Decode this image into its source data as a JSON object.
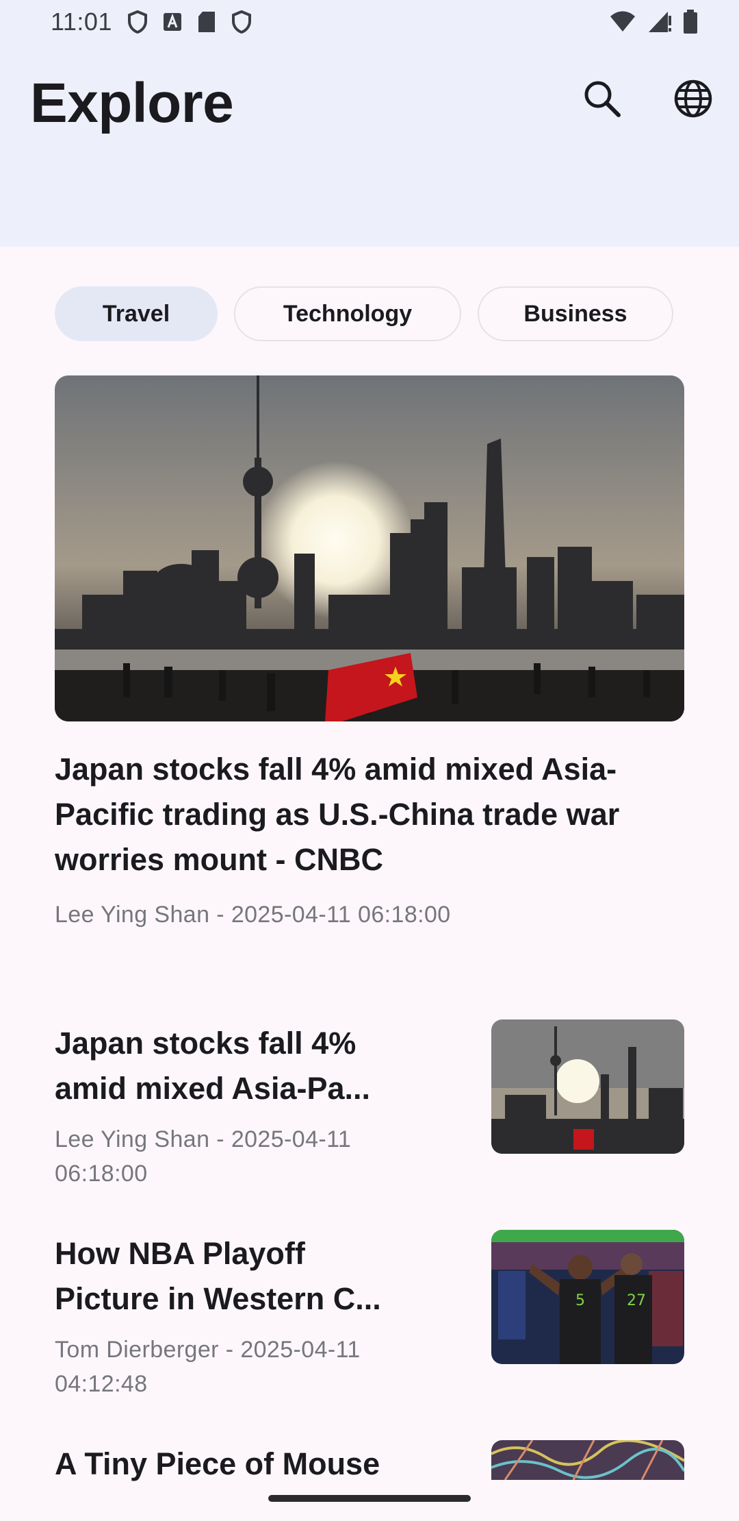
{
  "status_bar": {
    "time": "11:01",
    "left_icons": [
      "shield-icon",
      "a-badge-icon",
      "sd-card-icon",
      "shield-icon"
    ],
    "right_icons": [
      "wifi-icon",
      "signal-icon",
      "battery-icon"
    ]
  },
  "header": {
    "title": "Explore",
    "actions": [
      "search-icon",
      "globe-icon"
    ]
  },
  "tabs": [
    {
      "label": "Travel",
      "selected": true
    },
    {
      "label": "Technology",
      "selected": false
    },
    {
      "label": "Business",
      "selected": false
    }
  ],
  "featured": {
    "title": "Japan stocks fall 4% amid mixed Asia-Pacific trading as U.S.-China trade war worries mount - CNBC",
    "meta": "Lee Ying Shan - 2025-04-11 06:18:00"
  },
  "articles": [
    {
      "title": "Japan stocks fall 4% amid mixed Asia-Pa...",
      "meta": "Lee Ying Shan - 2025-04-11 06:18:00"
    },
    {
      "title": "How NBA Playoff Picture in Western C...",
      "meta": "Tom Dierberger - 2025-04-11 04:12:48"
    },
    {
      "title": "A Tiny Piece of Mouse",
      "meta": ""
    }
  ],
  "colors": {
    "header_bg": "#edf0fa",
    "page_bg": "#fdf7fc",
    "chip_selected": "#e4e8f5",
    "text_primary": "#1b1b1f",
    "text_secondary": "#76767d"
  }
}
